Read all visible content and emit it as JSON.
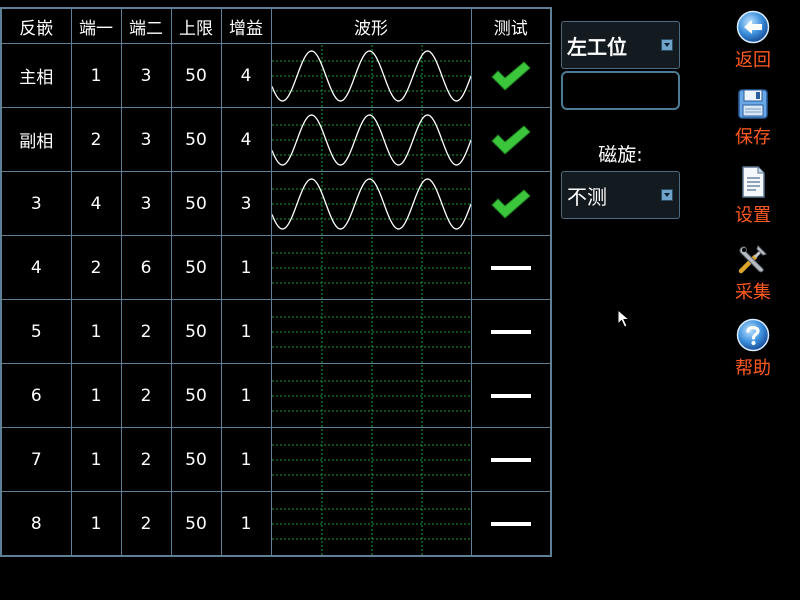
{
  "table": {
    "headers": [
      "反嵌",
      "端一",
      "端二",
      "上限",
      "增益",
      "波形",
      "测试"
    ],
    "rows": [
      {
        "name": "主相",
        "port1": "1",
        "port2": "3",
        "limit": "50",
        "gain": "4",
        "wave": true,
        "test": "pass"
      },
      {
        "name": "副相",
        "port1": "2",
        "port2": "3",
        "limit": "50",
        "gain": "4",
        "wave": true,
        "test": "pass"
      },
      {
        "name": "3",
        "port1": "4",
        "port2": "3",
        "limit": "50",
        "gain": "3",
        "wave": true,
        "test": "pass"
      },
      {
        "name": "4",
        "port1": "2",
        "port2": "6",
        "limit": "50",
        "gain": "1",
        "wave": false,
        "test": "none"
      },
      {
        "name": "5",
        "port1": "1",
        "port2": "2",
        "limit": "50",
        "gain": "1",
        "wave": false,
        "test": "none"
      },
      {
        "name": "6",
        "port1": "1",
        "port2": "2",
        "limit": "50",
        "gain": "1",
        "wave": false,
        "test": "none"
      },
      {
        "name": "7",
        "port1": "1",
        "port2": "2",
        "limit": "50",
        "gain": "1",
        "wave": false,
        "test": "none"
      },
      {
        "name": "8",
        "port1": "1",
        "port2": "2",
        "limit": "50",
        "gain": "1",
        "wave": false,
        "test": "none"
      }
    ]
  },
  "controls": {
    "station": "左工位",
    "input_value": "",
    "magnet_label": "磁旋:",
    "magnet_value": "不测"
  },
  "nav": {
    "back": "返回",
    "save": "保存",
    "settings": "设置",
    "collect": "采集",
    "help": "帮助"
  },
  "colors": {
    "grid_border": "#5f7f96",
    "wave_grid": "#1f9a3a",
    "pass_check": "#3cc63c",
    "nav_text": "#ff5a1f"
  },
  "icons": {
    "back": "back-arrow-icon",
    "save": "floppy-disk-icon",
    "settings": "document-icon",
    "collect": "tools-icon",
    "help": "help-question-icon",
    "pass": "check-icon",
    "none": "dash-icon"
  }
}
